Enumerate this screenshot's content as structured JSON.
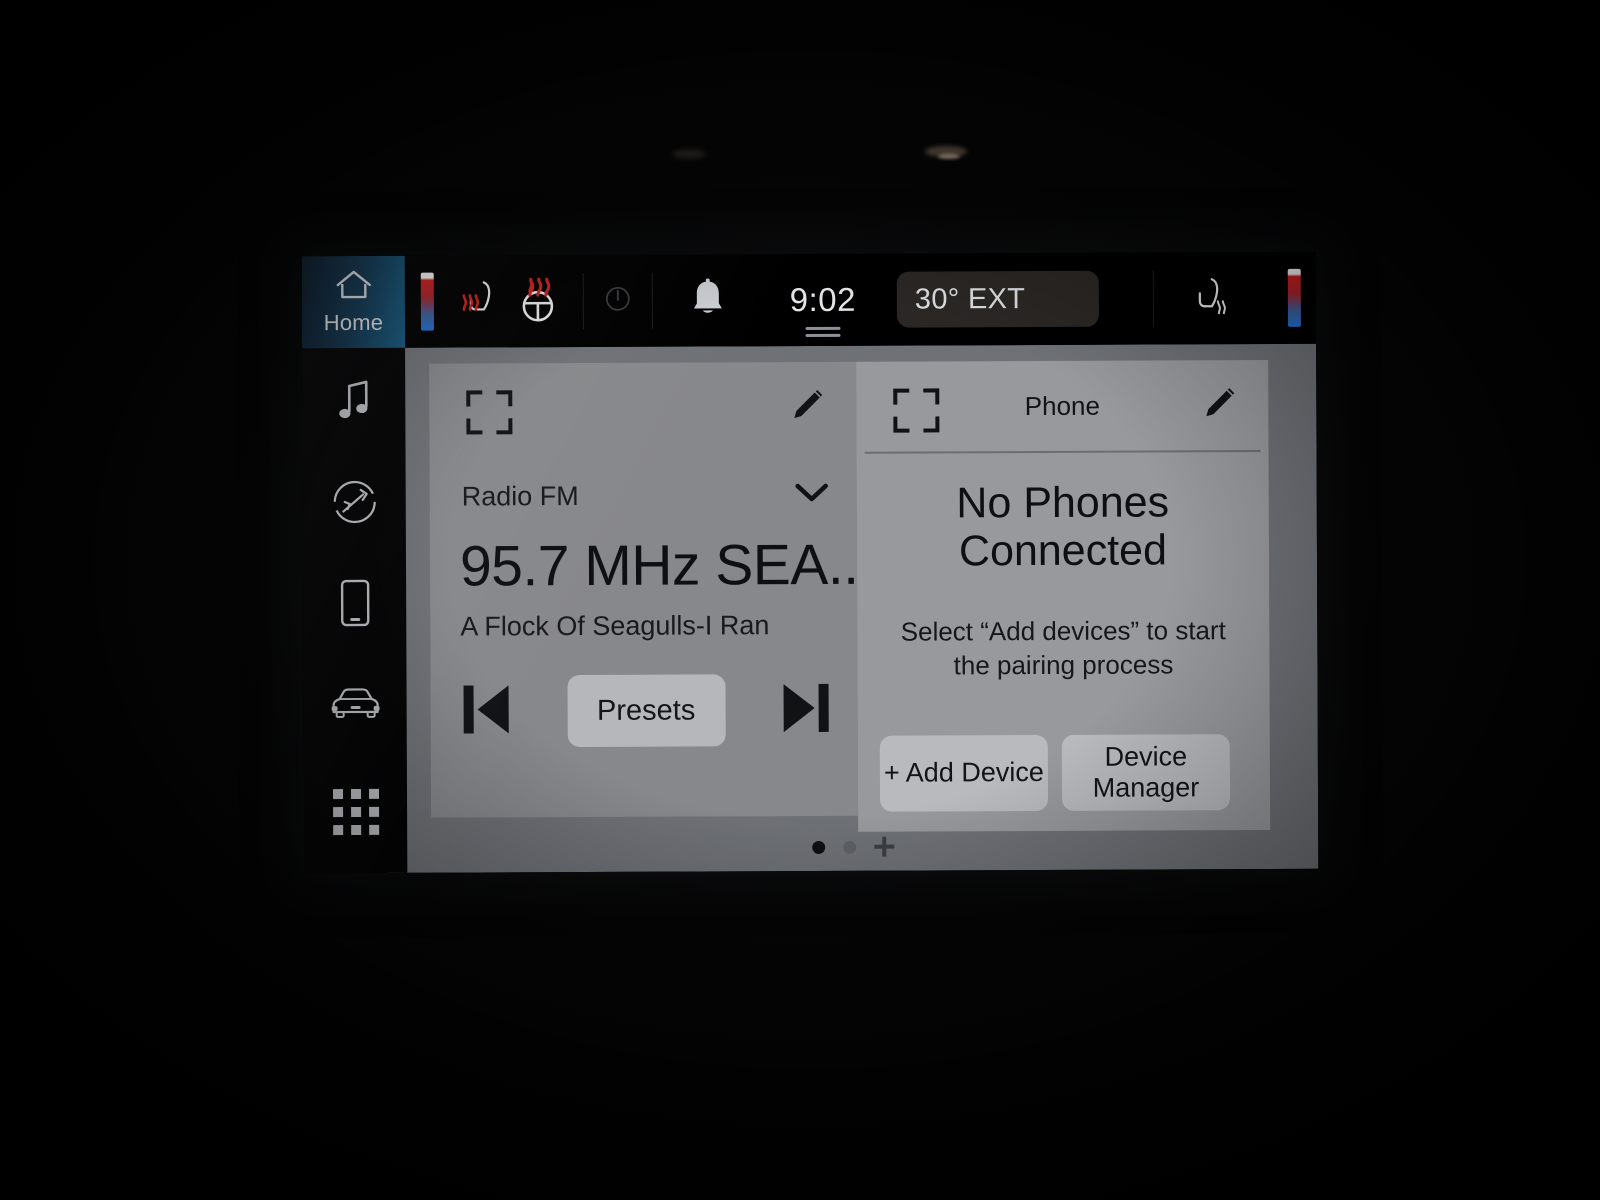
{
  "statusbar": {
    "home_label": "Home",
    "home_icon": "house-icon",
    "driver_temp_icon": "driver-temperature-bar",
    "heated_seat_icon": "heated-seat-icon",
    "heated_steering_icon": "heated-steering-wheel-icon",
    "power_icon": "power-indicator-icon",
    "notification_icon": "bell-icon",
    "clock": "9:02",
    "exterior_temp": "30° EXT",
    "passenger_seat_icon": "ventilated-seat-icon",
    "passenger_temp_icon": "passenger-temperature-bar",
    "drag_handle_icon": "drag-handle-icon"
  },
  "sidebar": {
    "items": [
      {
        "name": "media",
        "icon": "music-note-icon"
      },
      {
        "name": "navigation",
        "icon": "navigation-compass-icon"
      },
      {
        "name": "phone",
        "icon": "phone-device-icon"
      },
      {
        "name": "vehicle",
        "icon": "car-front-icon"
      },
      {
        "name": "apps",
        "icon": "apps-grid-icon"
      }
    ]
  },
  "radio_card": {
    "expand_icon": "expand-fullscreen-icon",
    "edit_icon": "pencil-edit-icon",
    "source": "Radio FM",
    "source_chevron_icon": "chevron-down-icon",
    "frequency": "95.7 MHz SEA...",
    "track": "A Flock Of Seagulls-I Ran",
    "prev_icon": "previous-track-icon",
    "presets_label": "Presets",
    "next_icon": "next-track-icon"
  },
  "phone_card": {
    "expand_icon": "expand-fullscreen-icon",
    "title": "Phone",
    "edit_icon": "pencil-edit-icon",
    "status_line1": "No Phones",
    "status_line2": "Connected",
    "hint_line1": "Select “Add devices” to start",
    "hint_line2": "the pairing process",
    "add_device_label": "+ Add Device",
    "device_manager_line1": "Device",
    "device_manager_line2": "Manager"
  },
  "pager": {
    "dots": [
      true,
      false
    ],
    "add_icon": "add-page-icon"
  },
  "colors": {
    "screen_background": "#000000",
    "home_tile_accent": "#15597f",
    "panel_background": "#6e7176",
    "radio_card": "#87888b",
    "phone_card": "#98999c",
    "button_face": "#b9babd",
    "heat_indicator": "#c91f1f",
    "cold_indicator": "#1f6fd0",
    "text_primary": "#0d0f11",
    "status_text": "#e3e5e8"
  }
}
